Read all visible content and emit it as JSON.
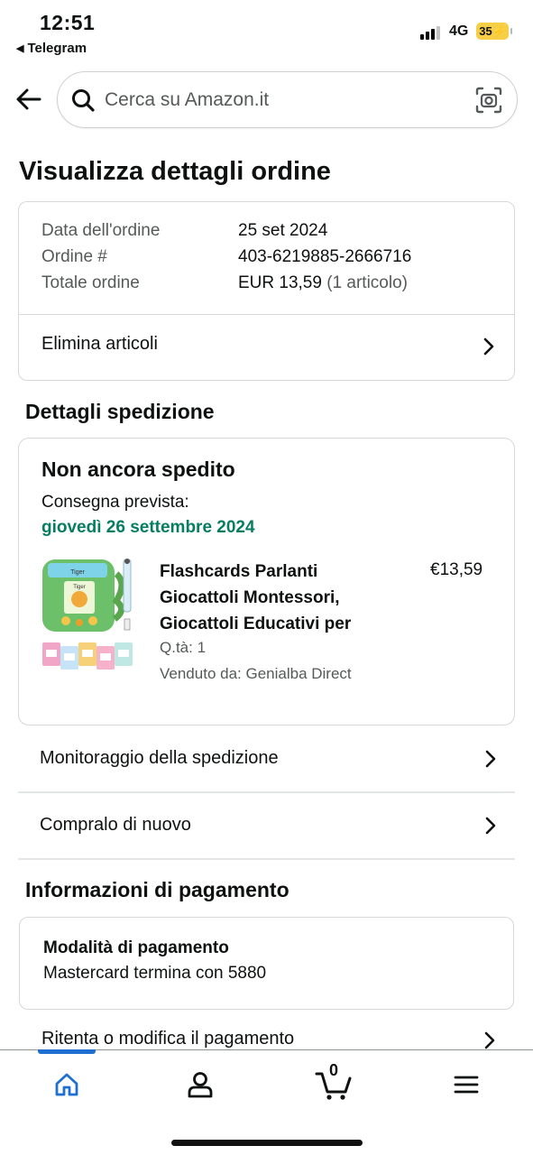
{
  "status_bar": {
    "time": "12:51",
    "back_app": "Telegram",
    "network": "4G",
    "battery": "35"
  },
  "search": {
    "placeholder": "Cerca su Amazon.it"
  },
  "page": {
    "title": "Visualizza dettagli ordine"
  },
  "order_summary": {
    "rows": [
      {
        "label": "Data dell'ordine",
        "value": "25 set 2024"
      },
      {
        "label": "Ordine #",
        "value": "403-6219885-2666716"
      },
      {
        "label": "Totale ordine",
        "value": "EUR 13,59",
        "suffix": "(1 articolo)"
      }
    ],
    "delete_items_label": "Elimina articoli"
  },
  "shipping": {
    "section_title": "Dettagli spedizione",
    "status": "Non ancora spedito",
    "eta_label": "Consegna prevista:",
    "eta_date": "giovedì 26 settembre 2024",
    "eta_color": "#067d62",
    "product": {
      "title_lines": [
        "Flashcards Parlanti",
        "Giocattoli Montessori,",
        "Giocattoli Educativi per"
      ],
      "price": "€13,59",
      "quantity": "Q.tà: 1",
      "seller": "Venduto da: Genialba Direct",
      "image_labels": [
        "Tiger",
        "Tiger"
      ]
    }
  },
  "actions": {
    "track": "Monitoraggio della spedizione",
    "buy_again": "Compralo di nuovo"
  },
  "payment": {
    "section_title": "Informazioni di pagamento",
    "method_title": "Modalità di pagamento",
    "method_value": "Mastercard  termina con 5880",
    "retry_label": "Ritenta o modifica il pagamento"
  },
  "tabbar": {
    "cart_count": "0",
    "active_color": "#1f6fd1",
    "tabs": [
      "home-icon",
      "account-icon",
      "cart-icon",
      "menu-icon"
    ]
  }
}
